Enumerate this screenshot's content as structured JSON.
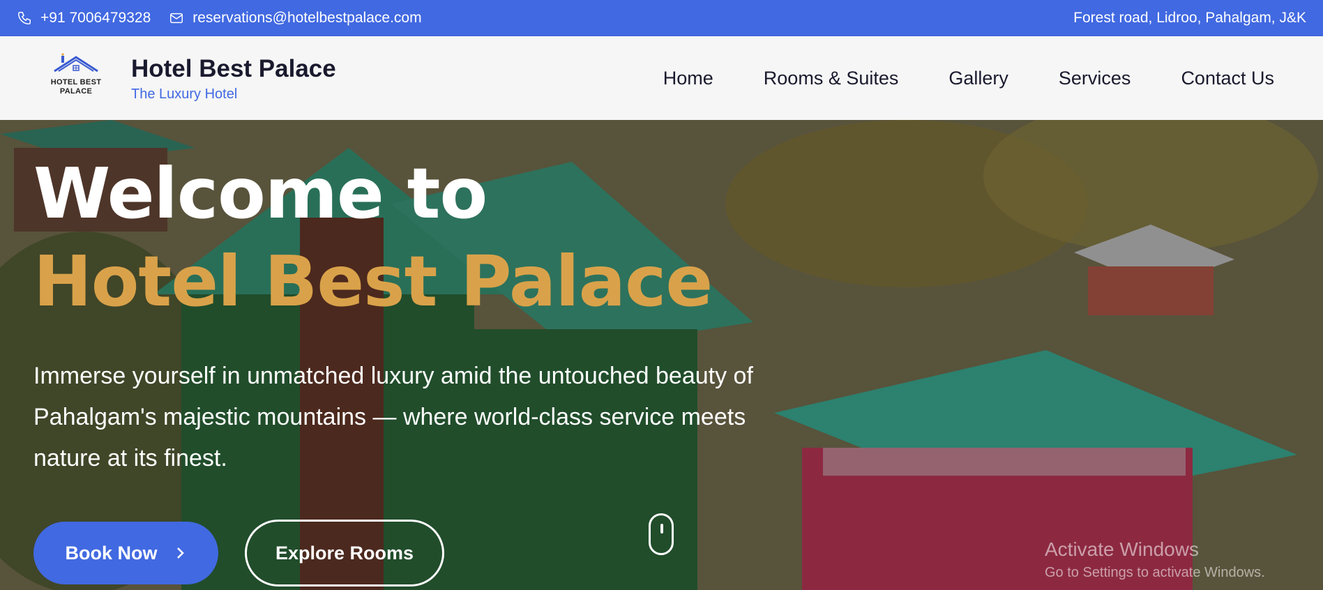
{
  "topbar": {
    "phone": "+91 7006479328",
    "email": "reservations@hotelbestpalace.com",
    "address": "Forest road, Lidroo, Pahalgam, J&K",
    "background_color": "#4169e1"
  },
  "header": {
    "logo_text_line1": "HOTEL BEST",
    "logo_text_line2": "PALACE",
    "brand_name": "Hotel Best Palace",
    "tagline": "The Luxury Hotel",
    "nav": [
      {
        "label": "Home"
      },
      {
        "label": "Rooms & Suites"
      },
      {
        "label": "Gallery"
      },
      {
        "label": "Services"
      },
      {
        "label": "Contact Us"
      }
    ]
  },
  "hero": {
    "title_line1": "Welcome to",
    "title_line2": "Hotel Best Palace",
    "description": "Immerse yourself in unmatched luxury amid the untouched beauty of Pahalgam's majestic mountains — where world-class service meets nature at its finest.",
    "book_button": "Book Now",
    "explore_button": "Explore Rooms",
    "accent_color": "#d9a24a"
  },
  "os_watermark": {
    "line1": "Activate Windows",
    "line2": "Go to Settings to activate Windows."
  }
}
